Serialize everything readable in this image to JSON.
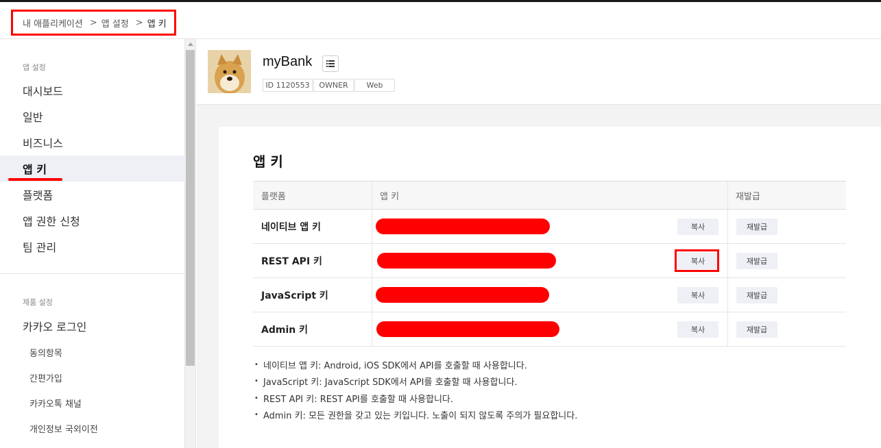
{
  "breadcrumb": {
    "items": [
      "내 애플리케이션",
      "앱 설정",
      "앱 키"
    ],
    "separator": ">"
  },
  "sidebar": {
    "section1_title": "앱 설정",
    "items": [
      {
        "label": "대시보드",
        "active": false
      },
      {
        "label": "일반",
        "active": false
      },
      {
        "label": "비즈니스",
        "active": false
      },
      {
        "label": "앱 키",
        "active": true
      },
      {
        "label": "플랫폼",
        "active": false
      },
      {
        "label": "앱 권한 신청",
        "active": false
      },
      {
        "label": "팀 관리",
        "active": false
      }
    ],
    "section2_title": "제품 설정",
    "product_item": "카카오 로그인",
    "sub_items": [
      "동의항목",
      "간편가입",
      "카카오톡 채널",
      "개인정보 국외이전"
    ]
  },
  "app": {
    "name": "myBank",
    "tags": [
      "ID 1120553",
      "OWNER",
      "Web"
    ]
  },
  "card": {
    "title": "앱 키",
    "columns": [
      "플랫폼",
      "앱 키",
      "재발급"
    ],
    "rows": [
      {
        "platform": "네이티브 앱 키",
        "copy_label": "복사",
        "reissue_label": "재발급"
      },
      {
        "platform": "REST API 키",
        "copy_label": "복사",
        "reissue_label": "재발급"
      },
      {
        "platform": "JavaScript 키",
        "copy_label": "복사",
        "reissue_label": "재발급"
      },
      {
        "platform": "Admin 키",
        "copy_label": "복사",
        "reissue_label": "재발급"
      }
    ],
    "notes": [
      "네이티브 앱 키: Android, iOS SDK에서 API를 호출할 때 사용합니다.",
      "JavaScript 키: JavaScript SDK에서 API를 호출할 때 사용합니다.",
      "REST API 키: REST API를 호출할 때 사용합니다.",
      "Admin 키: 모든 권한을 갖고 있는 키입니다. 노출이 되지 않도록 주의가 필요합니다."
    ]
  },
  "colors": {
    "highlight": "#ff0000",
    "active_bg": "#eef0f5",
    "button_bg": "#eef0f5"
  }
}
